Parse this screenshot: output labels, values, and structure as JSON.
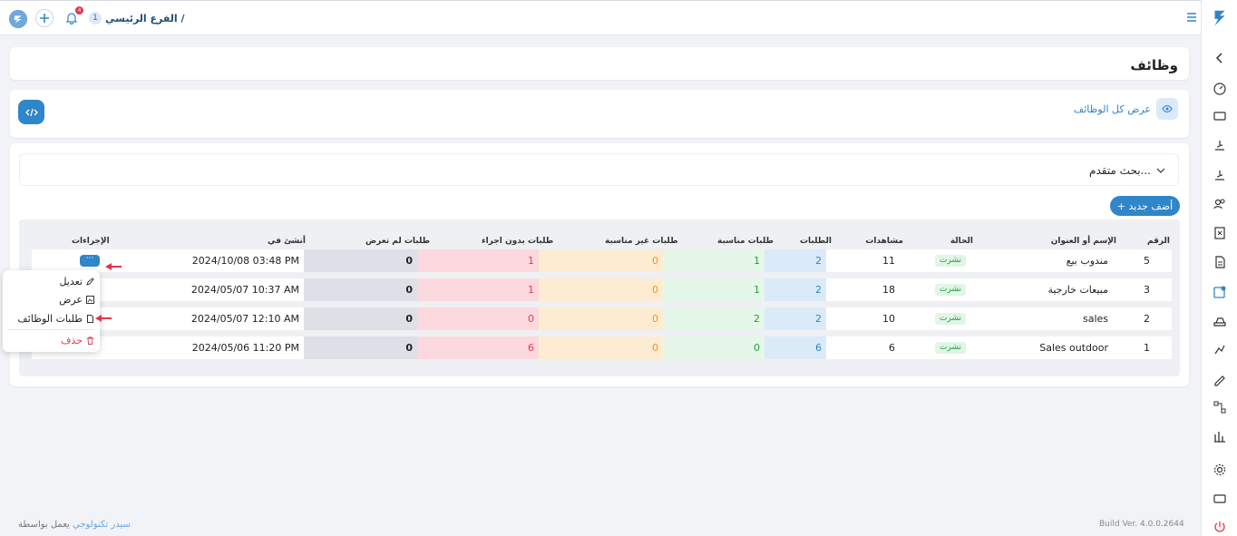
{
  "topbar": {
    "branch_label": "الفرع الرئيسي /",
    "branch_number": "1",
    "notification_count": "4"
  },
  "page": {
    "title": "وظائف"
  },
  "toolbar": {
    "view_all_label": "عرض كل الوظائف"
  },
  "search": {
    "advanced_label": "بحث متقدم..."
  },
  "actions": {
    "add_new_label": "+ أضف جديد"
  },
  "table": {
    "headers": {
      "num": "الرقم",
      "title": "الإسم أو العنوان",
      "status": "الحالة",
      "views": "مشاهدات",
      "applications": "الطلبات",
      "fit": "طلبات مناسبة",
      "unfit": "طلبات غير مناسبة",
      "no_action": "طلبات بدون اجراء",
      "unseen": "طلبات لم تعرض",
      "created": "أنشئ في",
      "actions": "الإجراءات"
    },
    "rows": [
      {
        "num": "5",
        "title": "مندوب بيع",
        "status": "نشرت",
        "views": "11",
        "applications": "2",
        "fit": "1",
        "unfit": "0",
        "no_action": "1",
        "unseen": "0",
        "created": "2024/10/08 03:48 PM"
      },
      {
        "num": "3",
        "title": "مبيعات خارجية",
        "status": "نشرت",
        "views": "18",
        "applications": "2",
        "fit": "1",
        "unfit": "0",
        "no_action": "1",
        "unseen": "0",
        "created": "2024/05/07 10:37 AM"
      },
      {
        "num": "2",
        "title": "sales",
        "status": "نشرت",
        "views": "10",
        "applications": "2",
        "fit": "2",
        "unfit": "0",
        "no_action": "0",
        "unseen": "0",
        "created": "2024/05/07 12:10 AM"
      },
      {
        "num": "1",
        "title": "Sales outdoor",
        "status": "نشرت",
        "views": "6",
        "applications": "6",
        "fit": "0",
        "unfit": "0",
        "no_action": "6",
        "unseen": "0",
        "created": "2024/05/06 11:20 PM"
      }
    ]
  },
  "menu": {
    "edit": "تعديل",
    "view": "عرض",
    "job_requests": "طلبات الوظائف",
    "delete": "حذف"
  },
  "footer": {
    "powered_prefix": "يعمل بواسطة",
    "powered_brand": "سيدر تكنولوجي",
    "build": "Build Ver. 4.0.0.2644"
  },
  "colors": {
    "accent": "#2f86c8",
    "danger": "#e5344a",
    "success": "#22a041"
  }
}
